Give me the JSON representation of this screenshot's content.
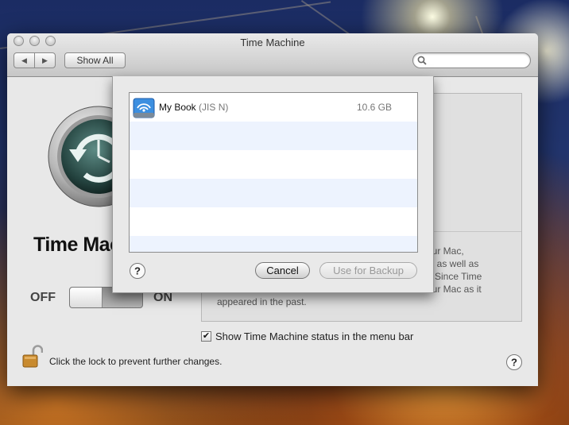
{
  "window": {
    "title": "Time Machine"
  },
  "toolbar": {
    "back_icon": "back-arrow-icon",
    "forward_icon": "forward-arrow-icon",
    "show_all_label": "Show All",
    "search_placeholder": ""
  },
  "main": {
    "app_name": "Time Machine",
    "switch": {
      "off_label": "OFF",
      "on_label": "ON",
      "state": "off"
    },
    "info_text": [
      "our Mac,",
      "s, as well as",
      "Since Time",
      "our Mac as it",
      "appeared in the past."
    ],
    "status_checkbox": {
      "label": "Show Time Machine status in the menu bar",
      "checked": true
    },
    "lock_label": "Click the lock to prevent further changes."
  },
  "sheet": {
    "disks": [
      {
        "name": "My Book",
        "subtitle": "(JIS N)",
        "size": "10.6 GB",
        "icon": "airport-disk-icon"
      }
    ],
    "cancel_label": "Cancel",
    "use_label": "Use for Backup"
  },
  "colors": {
    "row_stripe": "#edf3fe",
    "disabled_text": "#999999"
  }
}
